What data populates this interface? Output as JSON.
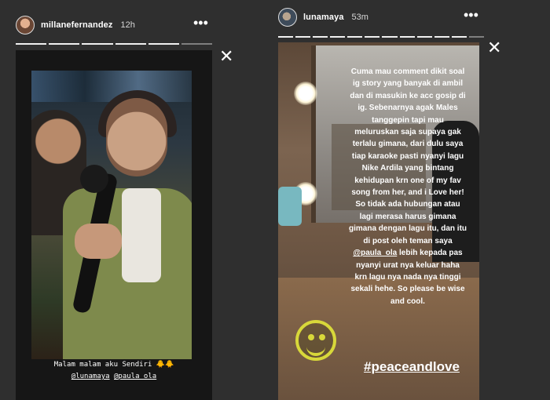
{
  "stories": {
    "left": {
      "username": "millanefernandez",
      "time": "12h",
      "progress_segments": 6,
      "progress_done": 5,
      "caption_line1": "Malam malam aku Sendiri 🐥🐥",
      "mention1": "@lunamaya",
      "mention2": "@paula_ola"
    },
    "right": {
      "username": "lunamaya",
      "time": "53m",
      "progress_segments": 12,
      "progress_done": 11,
      "caption_text": "Cuma mau comment dikit soal ig story yang banyak di ambil dan di masukin ke acc gosip di ig. Sebenarnya agak Males tanggepin tapi mau meluruskan saja supaya gak terlalu gimana, dari dulu saya tiap karaoke pasti nyanyi lagu Nike Ardila yang bintang kehidupan krn one of my fav song from her, and i Love her! So tidak ada hubungan atau lagi merasa harus gimana gimana dengan lagu itu, dan itu di post oleh teman saya",
      "mention": "@paula_ola",
      "caption_after": "lebih kepada pas nyanyi urat nya keluar haha krn lagu nya nada nya tinggi sekali hehe. So please be wise and cool.",
      "hashtag": "#peaceandlove"
    }
  },
  "icons": {
    "more": "more-options-icon",
    "close": "close-icon",
    "smiley": "smiley-sticker-icon"
  },
  "symbols": {
    "more": "•••",
    "close": "✕"
  },
  "colors": {
    "background": "#2f2f2f",
    "progress_done": "#f0f0f0",
    "progress_pending": "#7f7f7f",
    "sticker": "#d8d83a"
  }
}
